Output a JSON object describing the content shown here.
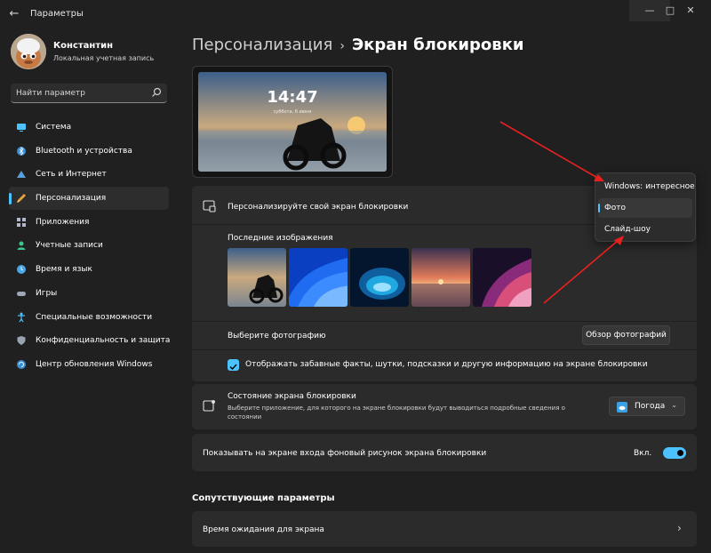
{
  "window": {
    "title": "Параметры",
    "back_icon": "arrow-left-icon",
    "minimize_icon": "minimize-icon",
    "maximize_icon": "maximize-icon",
    "close_icon": "close-icon"
  },
  "profile": {
    "name": "Константин",
    "account_type": "Локальная учетная запись"
  },
  "search": {
    "placeholder": "Найти параметр",
    "icon": "search-icon"
  },
  "sidebar": {
    "items": [
      {
        "label": "Система",
        "icon": "monitor-icon",
        "color": "#4cc2ff"
      },
      {
        "label": "Bluetooth и устройства",
        "icon": "bluetooth-icon",
        "color": "#3a8fd9"
      },
      {
        "label": "Сеть и Интернет",
        "icon": "network-icon",
        "color": "#5aa0e0"
      },
      {
        "label": "Персонализация",
        "icon": "brush-icon",
        "color": "#e8a33a",
        "active": true
      },
      {
        "label": "Приложения",
        "icon": "apps-icon",
        "color": "#b0b8c8"
      },
      {
        "label": "Учетные записи",
        "icon": "person-icon",
        "color": "#3cc48a"
      },
      {
        "label": "Время и язык",
        "icon": "globe-clock-icon",
        "color": "#4aa8e8"
      },
      {
        "label": "Игры",
        "icon": "gamepad-icon",
        "color": "#a0a8b8"
      },
      {
        "label": "Специальные возможности",
        "icon": "accessibility-icon",
        "color": "#4cc2ff"
      },
      {
        "label": "Конфиденциальность и защита",
        "icon": "shield-icon",
        "color": "#9aa2b0"
      },
      {
        "label": "Центр обновления Windows",
        "icon": "update-icon",
        "color": "#3a8fd9"
      }
    ]
  },
  "breadcrumb": {
    "parent": "Персонализация",
    "separator": "›",
    "current": "Экран блокировки"
  },
  "preview": {
    "time": "14:47",
    "date": "суббота, 6 июня"
  },
  "lockscreen": {
    "title": "Персонализируйте свой экран блокировки",
    "recent_label": "Последние изображения",
    "choose_photo_label": "Выберите фотографию",
    "browse_button": "Обзор фотографий",
    "fun_facts_label": "Отображать забавные факты, шутки, подсказки и другую информацию на экране блокировки",
    "fun_facts_checked": true
  },
  "dropdown": {
    "options": [
      "Windows: интересное",
      "Фото",
      "Слайд-шоу"
    ],
    "selected": "Фото"
  },
  "status": {
    "title": "Состояние экрана блокировки",
    "description": "Выберите приложение, для которого на экране блокировки будут выводиться подробные сведения о состоянии",
    "app_value": "Погода"
  },
  "signin_bg": {
    "label": "Показывать на экране входа фоновый рисунок экрана блокировки",
    "toggle_text": "Вкл.",
    "toggle_on": true
  },
  "related": {
    "title": "Сопутствующие параметры",
    "screen_timeout": "Время ожидания для экрана"
  },
  "colors": {
    "accent": "#4cc2ff",
    "background": "#202020",
    "card": "#2b2b2b",
    "annotation_arrow": "#e82020"
  }
}
